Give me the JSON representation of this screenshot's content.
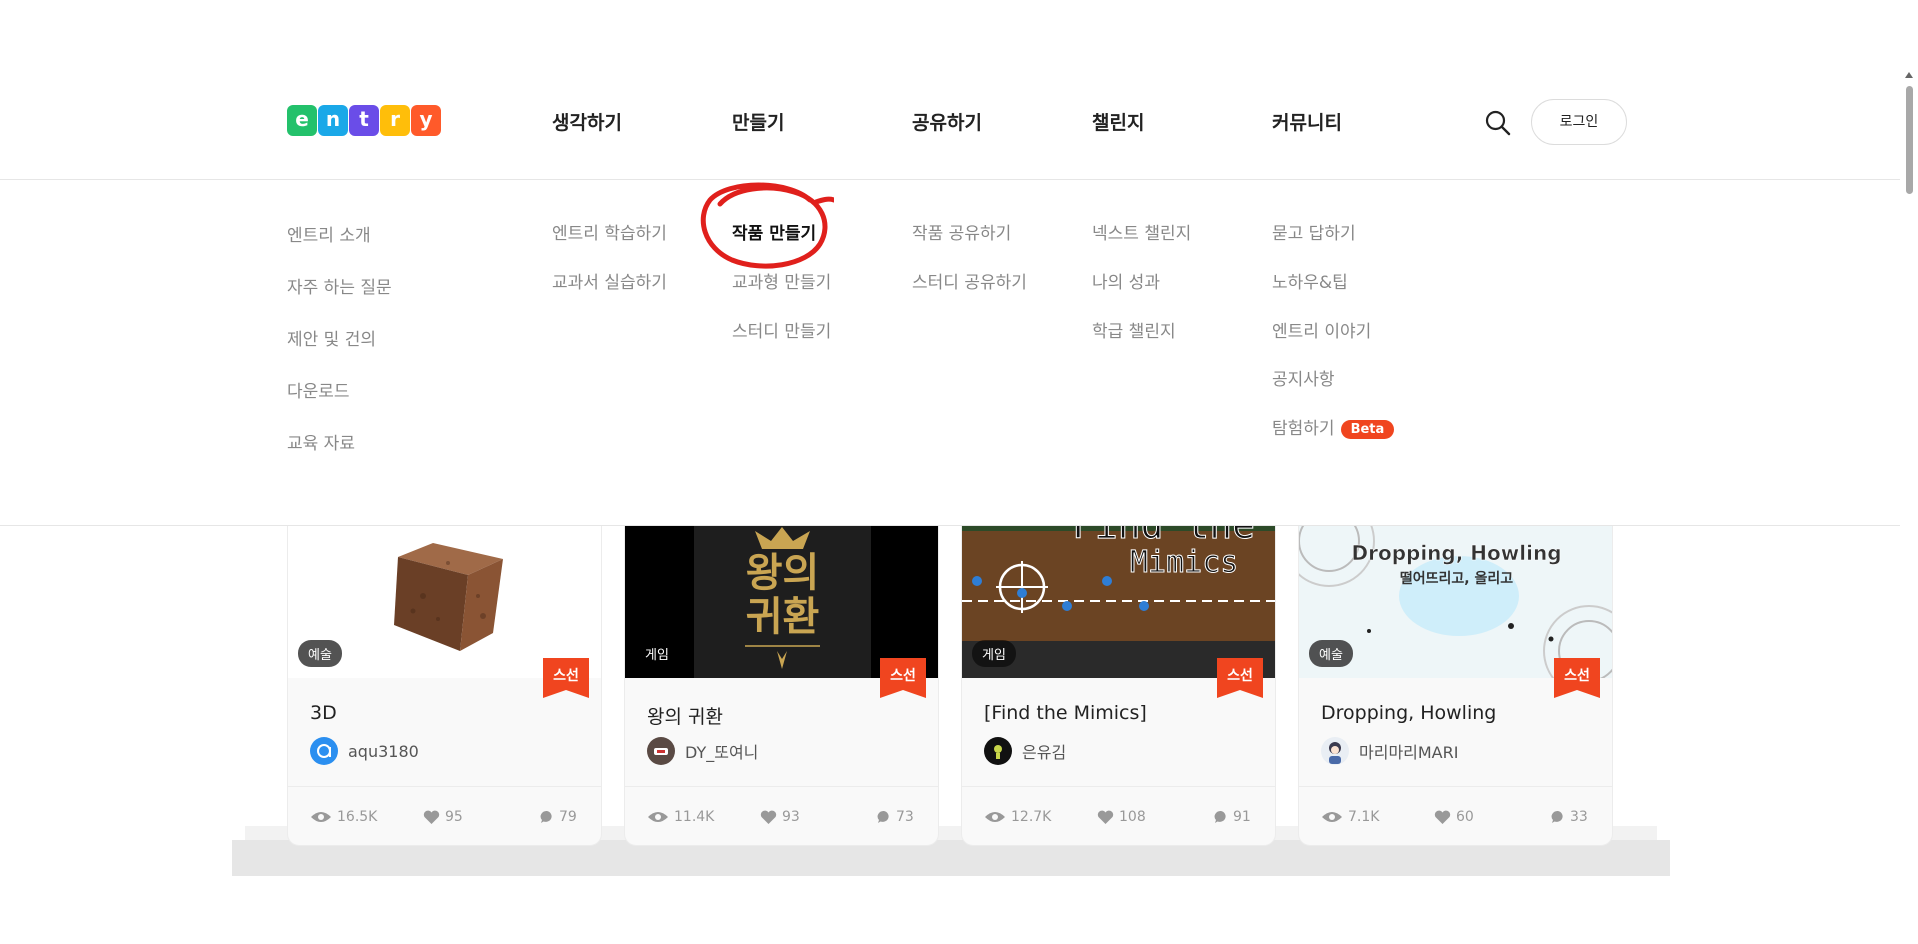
{
  "logo_letters": [
    {
      "char": "e",
      "color": "#23c16b"
    },
    {
      "char": "n",
      "color": "#1aa8e8"
    },
    {
      "char": "t",
      "color": "#6a4de8"
    },
    {
      "char": "r",
      "color": "#ffbe0a"
    },
    {
      "char": "y",
      "color": "#ff5a2a"
    }
  ],
  "nav": {
    "items": [
      "생각하기",
      "만들기",
      "공유하기",
      "챌린지",
      "커뮤니티"
    ],
    "login_label": "로그인"
  },
  "dropdown": {
    "think": [
      "엔트리 소개",
      "자주 하는 질문",
      "제안 및 건의",
      "다운로드",
      "교육 자료"
    ],
    "learn": [
      "엔트리 학습하기",
      "교과서 실습하기"
    ],
    "create": [
      "작품 만들기",
      "교과형 만들기",
      "스터디 만들기"
    ],
    "share": [
      "작품 공유하기",
      "스터디 공유하기"
    ],
    "challenge": [
      "넥스트 챌린지",
      "나의 성과",
      "학급 챌린지"
    ],
    "community": [
      "묻고 답하기",
      "노하우&팁",
      "엔트리 이야기",
      "공지사항",
      "탐험하기"
    ],
    "beta_label": "Beta",
    "highlight_color": "#e0201c"
  },
  "cards": [
    {
      "category": "예술",
      "staff_pick": "스선",
      "title": "3D",
      "author": "aqu3180",
      "views": "16.5K",
      "likes": "95",
      "comments": "79"
    },
    {
      "category": "게임",
      "staff_pick": "스선",
      "title": "왕의 귀환",
      "author": "DY_또여니",
      "views": "11.4K",
      "likes": "93",
      "comments": "73",
      "thumb_text": [
        "왕의",
        "귀환"
      ]
    },
    {
      "category": "게임",
      "staff_pick": "스선",
      "title": "[Find the Mimics]",
      "author": "은유김",
      "views": "12.7K",
      "likes": "108",
      "comments": "91",
      "thumb_text": [
        "Find the",
        "Mimics"
      ]
    },
    {
      "category": "예술",
      "staff_pick": "스선",
      "title": "Dropping, Howling",
      "author": "마리마리MARI",
      "views": "7.1K",
      "likes": "60",
      "comments": "33",
      "thumb_text": [
        "Dropping, Howling",
        "떨어뜨리고, 올리고"
      ]
    }
  ],
  "colors": {
    "staff_badge": "#f0451f",
    "accent": "#f0451f"
  }
}
